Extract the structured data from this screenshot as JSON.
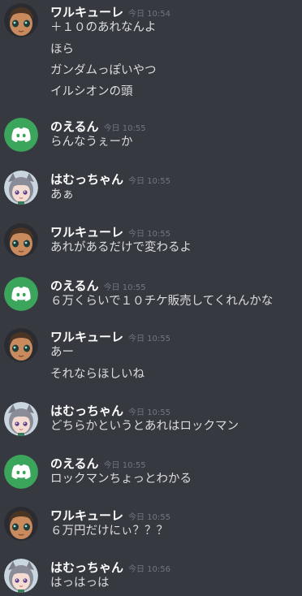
{
  "messages": [
    {
      "author": "ワルキューレ",
      "avatar": "walkure-avatar",
      "time": "今日 10:54",
      "lines": [
        "＋１０のあれなんよ",
        "ほら",
        "ガンダムっぽいやつ",
        "イルシオンの頭"
      ]
    },
    {
      "author": "のえるん",
      "avatar": "discord-avatar",
      "time": "今日 10:55",
      "lines": [
        "らんなうぇーか"
      ]
    },
    {
      "author": "はむっちゃん",
      "avatar": "hamucchan-avatar",
      "time": "今日 10:55",
      "lines": [
        "あぁ"
      ]
    },
    {
      "author": "ワルキューレ",
      "avatar": "walkure-avatar",
      "time": "今日 10:55",
      "lines": [
        "あれがあるだけで変わるよ"
      ]
    },
    {
      "author": "のえるん",
      "avatar": "discord-avatar",
      "time": "今日 10:55",
      "lines": [
        "６万くらいで１０チケ販売してくれんかな"
      ]
    },
    {
      "author": "ワルキューレ",
      "avatar": "walkure-avatar",
      "time": "今日 10:55",
      "lines": [
        "あー",
        "それならほしいね"
      ]
    },
    {
      "author": "はむっちゃん",
      "avatar": "hamucchan-avatar",
      "time": "今日 10:55",
      "lines": [
        "どちらかというとあれはロックマン"
      ]
    },
    {
      "author": "のえるん",
      "avatar": "discord-avatar",
      "time": "今日 10:55",
      "lines": [
        "ロックマンちょっとわかる"
      ]
    },
    {
      "author": "ワルキューレ",
      "avatar": "walkure-avatar",
      "time": "今日 10:55",
      "lines": [
        "６万円だけにぃ？？？"
      ]
    },
    {
      "author": "はむっちゃん",
      "avatar": "hamucchan-avatar",
      "time": "今日 10:56",
      "lines": [
        "はっはっは"
      ]
    }
  ],
  "colors": {
    "background": "#36393f",
    "username": "#ffffff",
    "message_text": "#dcddde",
    "timestamp": "#72767d",
    "discord_avatar_bg": "#3ba55c"
  }
}
